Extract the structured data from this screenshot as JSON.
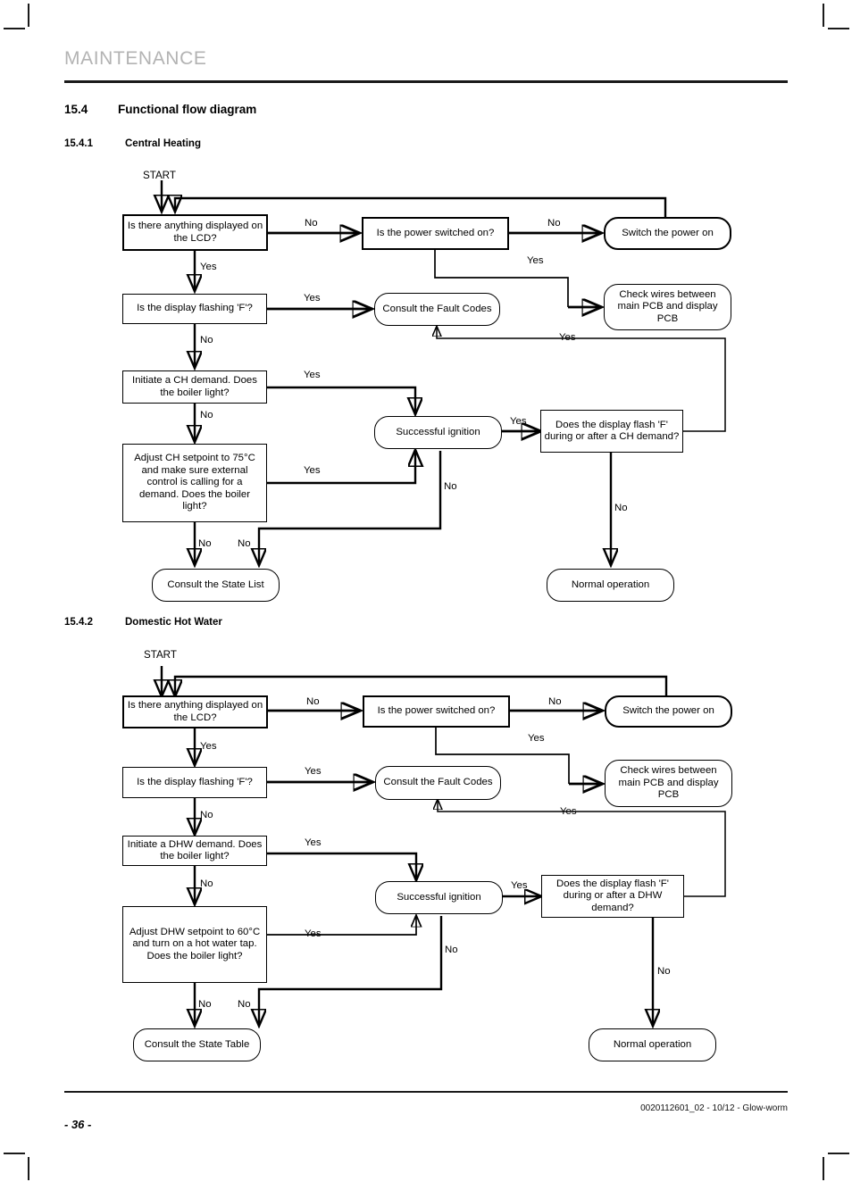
{
  "header": {
    "chapter_title": "MAINTENANCE"
  },
  "section": {
    "number": "15.4",
    "title": "Functional flow diagram"
  },
  "subsections": [
    {
      "number": "15.4.1",
      "title": "Central Heating"
    },
    {
      "number": "15.4.2",
      "title": "Domestic Hot Water"
    }
  ],
  "footer": {
    "page_number": "- 36 -",
    "doc_reference": "0020112601_02 - 10/12 - Glow-worm"
  },
  "flow_ch": {
    "start_label": "START",
    "nodes": {
      "lcd_display": "Is there anything displayed on the LCD?",
      "power_switched": "Is the power switched on?",
      "switch_power": "Switch the power on",
      "display_flashing_f": "Is the display flashing 'F'?",
      "fault_codes": "Consult the Fault Codes",
      "check_wires": "Check wires between main PCB and display PCB",
      "initiate_demand": "Initiate a CH demand. Does the boiler light?",
      "adjust_setpoint": "Adjust CH setpoint to 75°C and make sure external control is calling for a demand. Does the boiler light?",
      "successful_ignition": "Successful ignition",
      "flash_f_demand": "Does the display flash 'F' during or after a CH demand?",
      "state_list": "Consult the State List",
      "normal_operation": "Normal operation"
    },
    "edge_labels": {
      "lcd_no": "No",
      "lcd_yes": "Yes",
      "power_no": "No",
      "power_yes": "Yes",
      "flashing_yes": "Yes",
      "flashing_no": "No",
      "wires_yes": "Yes",
      "initiate_yes": "Yes",
      "initiate_no": "No",
      "adjust_yes": "Yes",
      "adjust_no": "No",
      "ignition_no": "No",
      "ignition_yes": "Yes",
      "flash_demand_yes": "Yes",
      "flash_demand_no": "No",
      "loop_no": "No"
    }
  },
  "flow_dhw": {
    "start_label": "START",
    "nodes": {
      "lcd_display": "Is there anything displayed on the LCD?",
      "power_switched": "Is the power switched on?",
      "switch_power": "Switch the power on",
      "display_flashing_f": "Is the display flashing 'F'?",
      "fault_codes": "Consult the Fault Codes",
      "check_wires": "Check wires between main PCB and display PCB",
      "initiate_demand": "Initiate a DHW demand. Does the boiler light?",
      "adjust_setpoint": "Adjust DHW setpoint to 60°C and turn on a hot water tap.\nDoes the boiler light?",
      "successful_ignition": "Successful ignition",
      "flash_f_demand": "Does the display flash 'F' during or after a DHW demand?",
      "state_table": "Consult the State Table",
      "normal_operation": "Normal operation"
    },
    "edge_labels": {
      "lcd_no": "No",
      "lcd_yes": "Yes",
      "power_no": "No",
      "power_yes": "Yes",
      "flashing_yes": "Yes",
      "flashing_no": "No",
      "wires_yes": "Yes",
      "initiate_yes": "Yes",
      "initiate_no": "No",
      "adjust_yes": "Yes",
      "adjust_no": "No",
      "ignition_no": "No",
      "ignition_yes": "Yes",
      "flash_demand_yes": "Yes",
      "flash_demand_no": "No",
      "loop_no": "No"
    }
  },
  "colors": {
    "ink": "#000000",
    "header_grey": "#b3b3b3",
    "rule": "#1a1a1a"
  }
}
